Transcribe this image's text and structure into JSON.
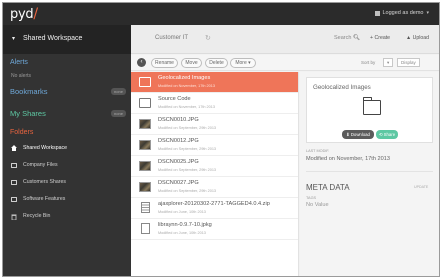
{
  "app": {
    "logo": "pyd",
    "logo_accent": "/"
  },
  "user": {
    "label": "Logged as demo",
    "caret": "▾"
  },
  "workspace": {
    "label": "Shared Workspace",
    "caret": "▾"
  },
  "sidebar": {
    "alerts": "Alerts",
    "alerts_sub": "No alerts",
    "bookmarks": "Bookmarks",
    "bookmarks_badge": "none",
    "shares": "My Shares",
    "shares_badge": "none",
    "folders": "Folders",
    "items": [
      {
        "label": "Shared Workspace",
        "icon": "home-icon"
      },
      {
        "label": "Company Files",
        "icon": "folder-icon"
      },
      {
        "label": "Customers Shares",
        "icon": "folder-icon"
      },
      {
        "label": "Software Features",
        "icon": "folder-icon"
      },
      {
        "label": "Recycle Bin",
        "icon": "trash-icon"
      }
    ]
  },
  "header": {
    "crumb": "Customer IT",
    "refresh": "↻",
    "search": "Search",
    "create": "+ Create",
    "upload": "Upload"
  },
  "toolbar": {
    "back": "‹",
    "rename": "Rename",
    "move": "Move",
    "delete": "Delete",
    "more": "More",
    "sort_by": "Sort by",
    "display_a": "▾",
    "display_b": "Display"
  },
  "files": [
    {
      "name": "Geolocalized Images",
      "meta": "Modified on November, 17th 2013",
      "type": "folder",
      "selected": true
    },
    {
      "name": "Source Code",
      "meta": "Modified on November, 17th 2013",
      "type": "folder"
    },
    {
      "name": "DSCN0010.JPG",
      "meta": "Modified on September, 29th 2013",
      "type": "image"
    },
    {
      "name": "DSCN0012.JPG",
      "meta": "Modified on September, 29th 2013",
      "type": "image"
    },
    {
      "name": "DSCN0025.JPG",
      "meta": "Modified on September, 29th 2013",
      "type": "image"
    },
    {
      "name": "DSCN0027.JPG",
      "meta": "Modified on September, 29th 2013",
      "type": "image"
    },
    {
      "name": "ajaxplorer-20120302-2771-TAGGED4.0.4.zip",
      "meta": "Modified on June, 10th 2013",
      "type": "zip"
    },
    {
      "name": "libraynn-0.9.7-10.jpkg",
      "meta": "Modified on June, 10th 2013",
      "type": "doc"
    }
  ],
  "details": {
    "title": "Geolocalized Images",
    "download": "Download",
    "share": "Share",
    "last_mod_label": "Last Modif.",
    "last_mod_value": "Modified on November, 17th 2013",
    "meta_title": "META DATA",
    "meta_update": "Update",
    "tag_label": "Tags",
    "tag_value": "No Value"
  },
  "colors": {
    "accent": "#ef7559",
    "share": "#5ec8a3",
    "sidebar": "#333333"
  }
}
